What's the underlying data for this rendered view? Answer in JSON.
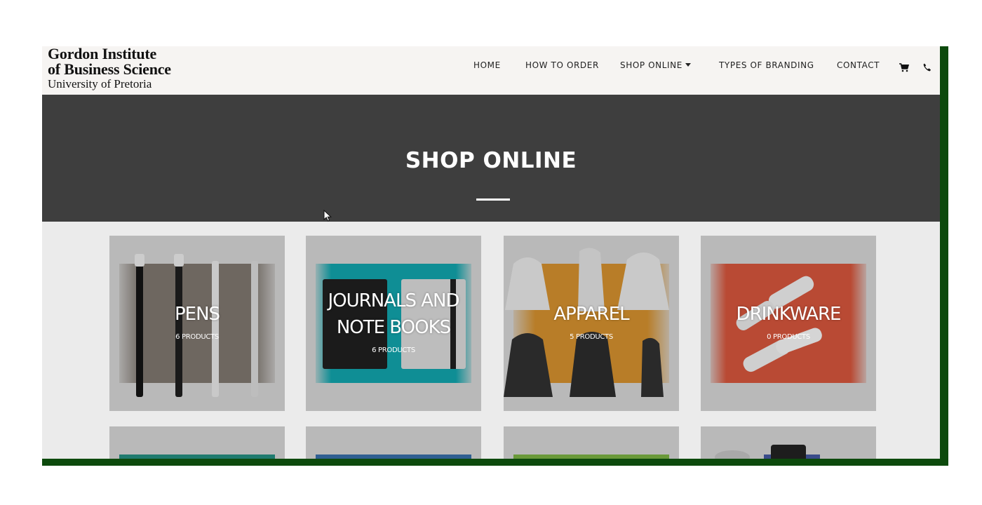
{
  "logo": {
    "line1": "Gordon Institute",
    "line2": "of Business Science",
    "line3": "University of Pretoria"
  },
  "nav": {
    "home": "HOME",
    "how_to_order": "HOW TO ORDER",
    "shop_online": "SHOP ONLINE",
    "types_of_branding": "TYPES OF BRANDING",
    "contact": "CONTACT"
  },
  "icons": [
    "cart-icon",
    "phone-icon",
    "chevron-down-icon",
    "mouse-pointer-icon"
  ],
  "hero": {
    "title": "SHOP ONLINE"
  },
  "categories": [
    {
      "name": "PENS",
      "count": "6 PRODUCTS",
      "band_color": "#6e6760"
    },
    {
      "name": "JOURNALS AND NOTE BOOKS",
      "name_line1": "JOURNALS AND",
      "name_line2": "NOTE BOOKS",
      "count": "6 PRODUCTS",
      "band_color": "#0f8e95"
    },
    {
      "name": "APPAREL",
      "count": "5 PRODUCTS",
      "band_color": "#b87d28"
    },
    {
      "name": "DRINKWARE",
      "count": "0 PRODUCTS",
      "band_color": "#b94a34"
    }
  ],
  "row2_colors": [
    "#1f7b6f",
    "#2f5f92",
    "#6a9a3a",
    "#3a4c8a"
  ],
  "colors": {
    "header_bg": "#f6f4f2",
    "hero_bg": "#3e3e3e",
    "frame": "#0d4a0d",
    "tile_bg": "#b9b9b9"
  }
}
